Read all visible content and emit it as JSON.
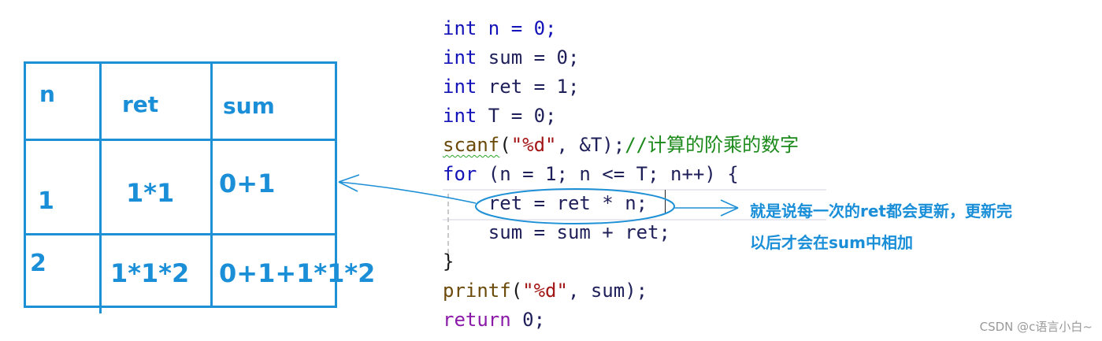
{
  "table": {
    "headers": [
      "n",
      "ret",
      "sum"
    ],
    "rows": [
      [
        "1",
        "1*1",
        "0+1"
      ],
      [
        "2",
        "1*1*2",
        "0+1+1*1*2"
      ]
    ]
  },
  "code": {
    "line0": "int n = 0;",
    "line1": {
      "kw": "int",
      "rest": " sum = 0;"
    },
    "line2": {
      "kw": "int",
      "rest": " ret = 1;"
    },
    "line3": {
      "kw": "int",
      "rest": " T = 0;"
    },
    "line4": {
      "fn": "scanf",
      "open": "(",
      "str": "\"%d\"",
      "rest": ", &T);",
      "comment": "//计算的阶乘的数字"
    },
    "line5": {
      "kw": "for",
      "rest": " (n = 1; n <= T; n++) {"
    },
    "line6": "    ret = ret * n;",
    "line7": "    sum = sum + ret;",
    "line8": "}",
    "line9": {
      "fn": "printf",
      "open": "(",
      "str": "\"%d\"",
      "rest": ", sum);"
    },
    "line10": {
      "kw": "return",
      "rest": " 0;"
    }
  },
  "annotation": {
    "line1": "就是说每一次的ret都会更新，更新完",
    "line2": "以后才会在sum中相加"
  },
  "colors": {
    "accent": "#1e90d6",
    "keyword": "#1212b8",
    "string": "#a31515",
    "comment": "#1b8a1b"
  },
  "watermark": "CSDN @c语言小白~"
}
